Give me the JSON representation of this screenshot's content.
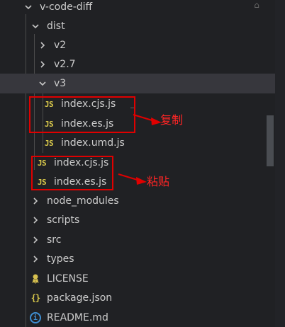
{
  "explorer": {
    "root": "v-code-diff",
    "dist": "dist",
    "v2": "v2",
    "v27": "v2.7",
    "v3": "v3",
    "v3_cjs": "index.cjs.js",
    "v3_es": "index.es.js",
    "v3_umd": "index.umd.js",
    "dist_cjs": "index.cjs.js",
    "dist_es": "index.es.js",
    "node_modules": "node_modules",
    "scripts": "scripts",
    "src": "src",
    "types": "types",
    "license": "LICENSE",
    "package_json": "package.json",
    "readme": "README.md"
  },
  "icons": {
    "js": "JS",
    "json": "{}",
    "info": "i",
    "license_color": "#d7c04f",
    "js_color": "#d8c84b",
    "info_color": "#3f8fd2"
  },
  "annotations": {
    "copy": "复制",
    "paste": "粘贴",
    "color": "#e00000"
  }
}
